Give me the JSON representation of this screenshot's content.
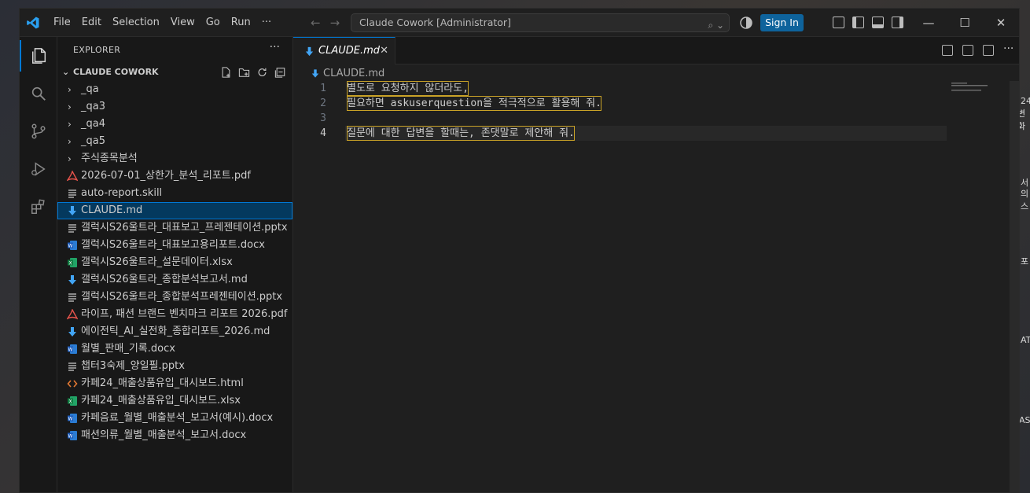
{
  "window": {
    "command_center": "Claude Cowork [Administrator]",
    "sign_in": "Sign In"
  },
  "menu": [
    "File",
    "Edit",
    "Selection",
    "View",
    "Go",
    "Run",
    "···"
  ],
  "sidebar": {
    "title": "EXPLORER",
    "more": "···",
    "folder": "CLAUDE COWORK",
    "folders": [
      "_qa",
      "_qa3",
      "_qa4",
      "_qa5",
      "주식종목분석"
    ],
    "files": [
      {
        "name": "2026-07-01_상한가_분석_리포트.pdf",
        "icon": "pdf-icon"
      },
      {
        "name": "auto-report.skill",
        "icon": "text-file-icon"
      },
      {
        "name": "CLAUDE.md",
        "icon": "markdown-icon"
      },
      {
        "name": "갤럭시S26울트라_대표보고_프레젠테이션.pptx",
        "icon": "text-file-icon"
      },
      {
        "name": "갤럭시S26울트라_대표보고용리포트.docx",
        "icon": "word-icon"
      },
      {
        "name": "갤럭시S26울트라_설문데이터.xlsx",
        "icon": "excel-icon"
      },
      {
        "name": "갤럭시S26울트라_종합분석보고서.md",
        "icon": "markdown-icon"
      },
      {
        "name": "갤럭시S26울트라_종합분석프레젠테이션.pptx",
        "icon": "text-file-icon"
      },
      {
        "name": "라이프, 패션 브랜드 벤치마크 리포트 2026.pdf",
        "icon": "pdf-icon"
      },
      {
        "name": "에이전틱_AI_실전화_종합리포트_2026.md",
        "icon": "markdown-icon"
      },
      {
        "name": "월별_판매_기록.docx",
        "icon": "word-icon"
      },
      {
        "name": "챕터3숙제_양일필.pptx",
        "icon": "text-file-icon"
      },
      {
        "name": "카페24_매출상품유입_대시보드.html",
        "icon": "html-icon"
      },
      {
        "name": "카페24_매출상품유입_대시보드.xlsx",
        "icon": "excel-icon"
      },
      {
        "name": "카페음료_월별_매출분석_보고서(예시).docx",
        "icon": "word-icon"
      },
      {
        "name": "패션의류_월별_매출분석_보고서.docx",
        "icon": "word-icon"
      }
    ]
  },
  "editor": {
    "tab": "CLAUDE.md",
    "close": "✕",
    "breadcrumb": "CLAUDE.md",
    "lines": [
      {
        "num": "1",
        "text": "별도로 요청하지 않더라도,"
      },
      {
        "num": "2",
        "text": "필요하면 askuserquestion을 적극적으로 활용해 줘."
      },
      {
        "num": "3",
        "text": ""
      },
      {
        "num": "4",
        "text": "질문에 대한 답변을 할때는, 존댓말로 제안해 줘."
      }
    ]
  },
  "desktop_edge": [
    "24",
    "변화",
    "서",
    "의스",
    "포",
    "AT",
    "AST"
  ],
  "colors": {
    "accent": "#0078d4",
    "signin": "#0e639c",
    "highlight": "#c9a227"
  }
}
